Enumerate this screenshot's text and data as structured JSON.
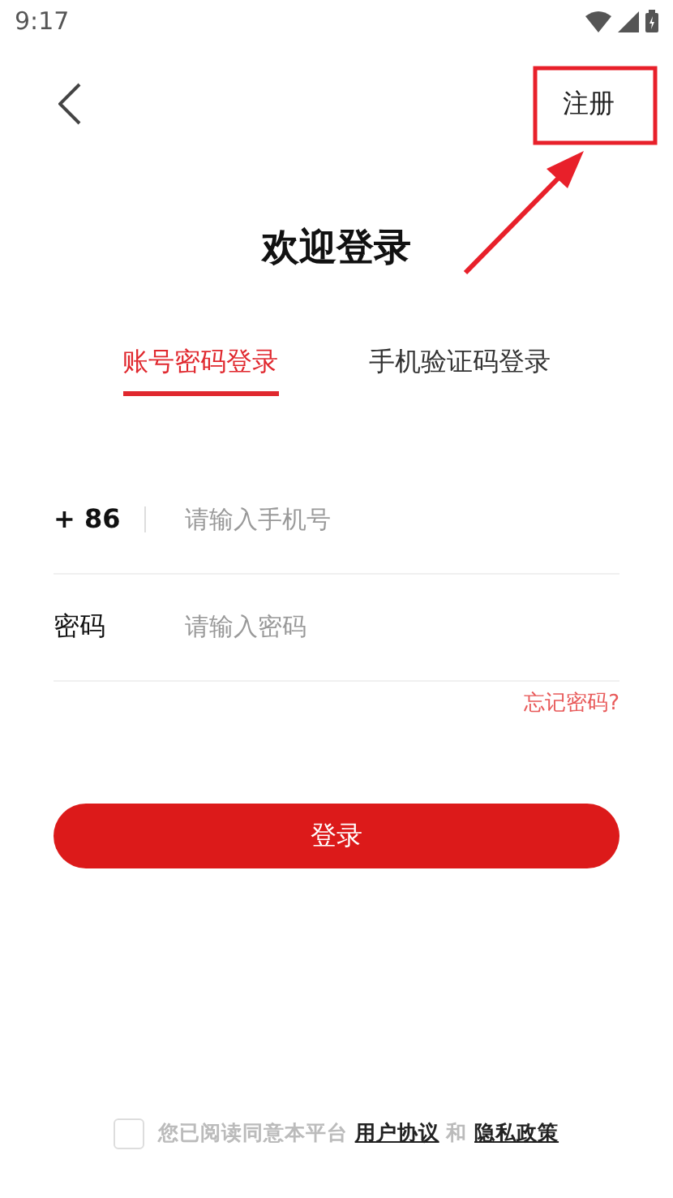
{
  "status_bar": {
    "time": "9:17"
  },
  "header": {
    "action": "注册",
    "action_highlighted": true
  },
  "title": "欢迎登录",
  "tabs": [
    {
      "label": "账号密码登录",
      "selected": true
    },
    {
      "label": "手机验证码登录",
      "selected": false
    }
  ],
  "phone": {
    "country_code": "+ 86",
    "placeholder": "请输入手机号"
  },
  "password": {
    "label": "密码",
    "placeholder": "请输入密码"
  },
  "forgot": "忘记密码?",
  "submit": "登录",
  "agreement": {
    "checked": false,
    "prefix": "您已阅读同意本平台",
    "link_1": "用户协议",
    "joiner": "和",
    "link_2": "隐私政策"
  }
}
